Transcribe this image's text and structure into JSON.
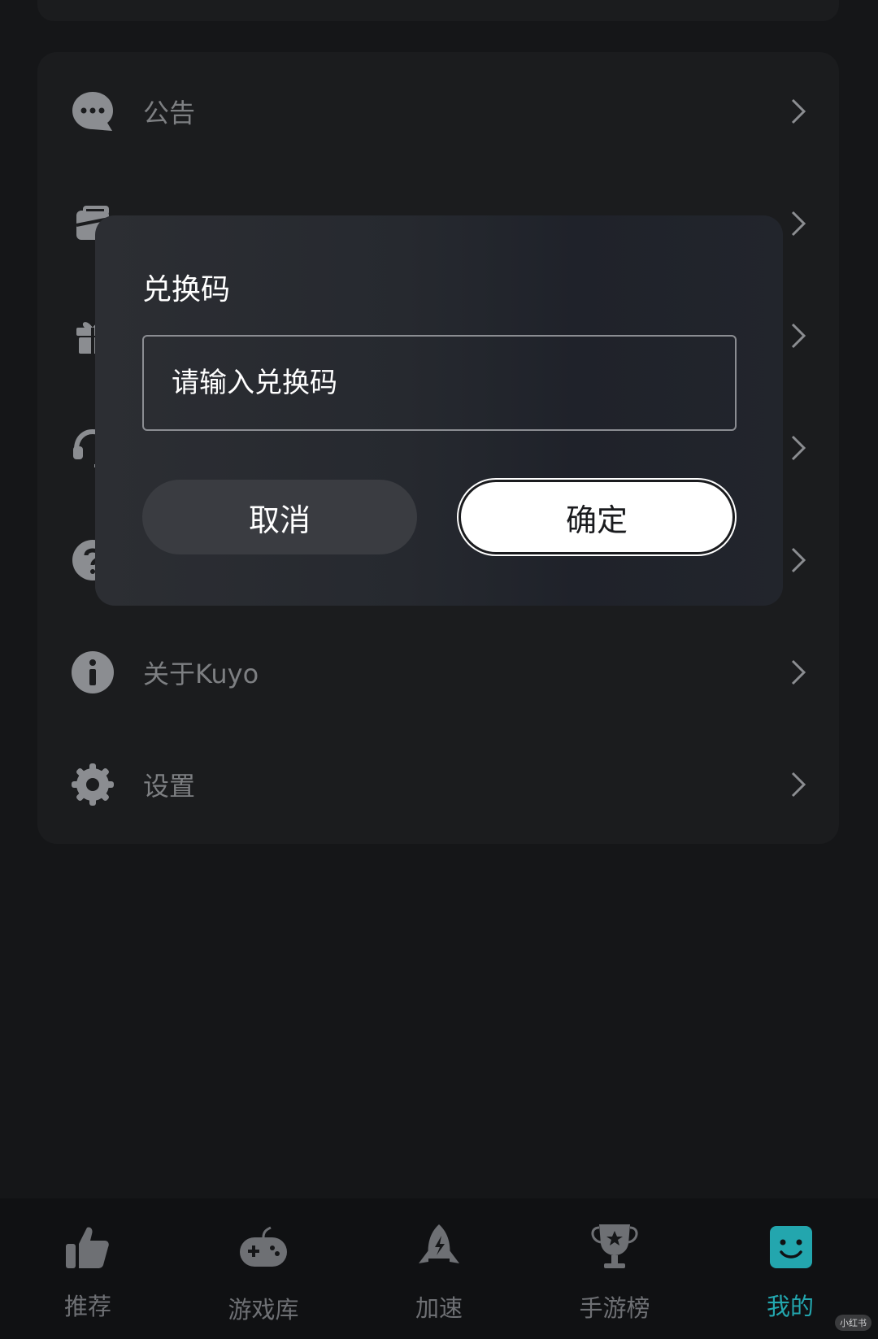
{
  "menu": {
    "items": [
      {
        "label": "公告",
        "icon": "announcement-icon"
      },
      {
        "label": "",
        "icon": "messages-icon"
      },
      {
        "label": "",
        "icon": "gift-icon"
      },
      {
        "label": "",
        "icon": "support-headset-icon"
      },
      {
        "label": "",
        "icon": "help-icon"
      },
      {
        "label": "关于Kuyo",
        "icon": "info-icon"
      },
      {
        "label": "设置",
        "icon": "gear-icon"
      }
    ]
  },
  "dialog": {
    "title": "兑换码",
    "input_placeholder": "请输入兑换码",
    "input_value": "",
    "cancel_label": "取消",
    "confirm_label": "确定"
  },
  "bottom_nav": {
    "items": [
      {
        "label": "推荐",
        "icon": "thumbs-up-icon",
        "active": false
      },
      {
        "label": "游戏库",
        "icon": "gamepad-icon",
        "active": false
      },
      {
        "label": "加速",
        "icon": "rocket-icon",
        "active": false
      },
      {
        "label": "手游榜",
        "icon": "trophy-icon",
        "active": false
      },
      {
        "label": "我的",
        "icon": "profile-face-icon",
        "active": true
      }
    ]
  },
  "colors": {
    "background": "#151618",
    "card": "#1b1c1e",
    "accent": "#23a6ae",
    "muted_text": "#7d7f82"
  },
  "watermark": "小红书"
}
